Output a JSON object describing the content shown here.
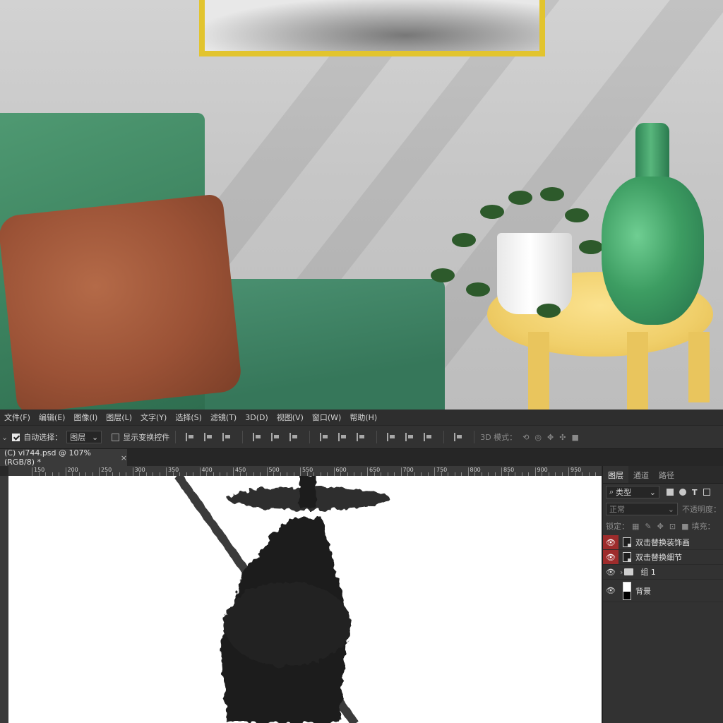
{
  "menubar": {
    "items": [
      "文件(F)",
      "编辑(E)",
      "图像(I)",
      "图层(L)",
      "文字(Y)",
      "选择(S)",
      "滤镜(T)",
      "3D(D)",
      "视图(V)",
      "窗口(W)",
      "帮助(H)"
    ]
  },
  "options_bar": {
    "auto_select_label": "自动选择：",
    "auto_select_checked": true,
    "auto_select_target": "图层",
    "show_transform_label": "显示变换控件",
    "show_transform_checked": false,
    "mode_3d_label": "3D 模式："
  },
  "document_tab": {
    "title": "(C) vi744.psd @ 107%(RGB/8) *",
    "close": "×"
  },
  "ruler": {
    "top_labels": [
      "150",
      "200",
      "250",
      "300",
      "350",
      "400",
      "450",
      "500",
      "550",
      "600",
      "650",
      "700",
      "750",
      "800",
      "850",
      "900",
      "950"
    ]
  },
  "layers_panel": {
    "tabs": [
      "图层",
      "通道",
      "路径"
    ],
    "active_tab": "图层",
    "filter_label": "类型",
    "blend_mode": "正常",
    "opacity_label": "不透明度：",
    "lock_label": "锁定：",
    "fill_label": "填充：",
    "layers": [
      {
        "name": "双击替换装饰画",
        "type": "smart",
        "highlighted_eye": true
      },
      {
        "name": "双击替换细节",
        "type": "smart",
        "highlighted_eye": true
      },
      {
        "name": "组 1",
        "type": "group",
        "highlighted_eye": false
      },
      {
        "name": "背景",
        "type": "background",
        "highlighted_eye": false
      }
    ]
  },
  "colors": {
    "eye_highlight": "#9e2c2c",
    "frame_gold": "#e2c42e",
    "chair_green": "#3d8460",
    "pillow_leather": "#9b5236",
    "table_yellow": "#f0cf6a",
    "vase_green": "#3d9d62"
  }
}
